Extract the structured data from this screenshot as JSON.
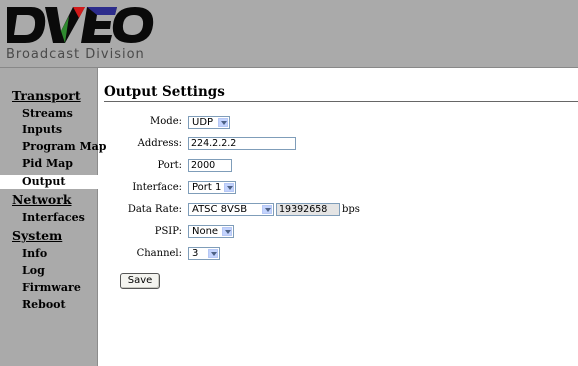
{
  "brand": {
    "logo_text": "DVEO",
    "subtitle": "Broadcast Division"
  },
  "nav": {
    "sections": [
      {
        "label": "Transport",
        "items": [
          "Streams",
          "Inputs",
          "Program Map",
          "Pid Map",
          "Output"
        ]
      },
      {
        "label": "Network",
        "items": [
          "Interfaces"
        ]
      },
      {
        "label": "System",
        "items": [
          "Info",
          "Log",
          "Firmware",
          "Reboot"
        ]
      }
    ],
    "active_item": "Output"
  },
  "page": {
    "title": "Output Settings"
  },
  "form": {
    "mode": {
      "label": "Mode:",
      "value": "UDP"
    },
    "address": {
      "label": "Address:",
      "value": "224.2.2.2"
    },
    "port": {
      "label": "Port:",
      "value": "2000"
    },
    "interface": {
      "label": "Interface:",
      "value": "Port 1"
    },
    "data_rate": {
      "label": "Data Rate:",
      "value": "ATSC 8VSB",
      "rate": "19392658",
      "unit": "bps"
    },
    "psip": {
      "label": "PSIP:",
      "value": "None"
    },
    "channel": {
      "label": "Channel:",
      "value": "3"
    },
    "save_label": "Save"
  },
  "colors": {
    "sidebar_bg": "#aaaaaa",
    "header_bg": "#aaaaaa",
    "logo_dark": "#0a0a0a",
    "logo_red": "#d21a1a",
    "logo_green": "#2f8a2f",
    "logo_blue": "#2c2c8c"
  }
}
